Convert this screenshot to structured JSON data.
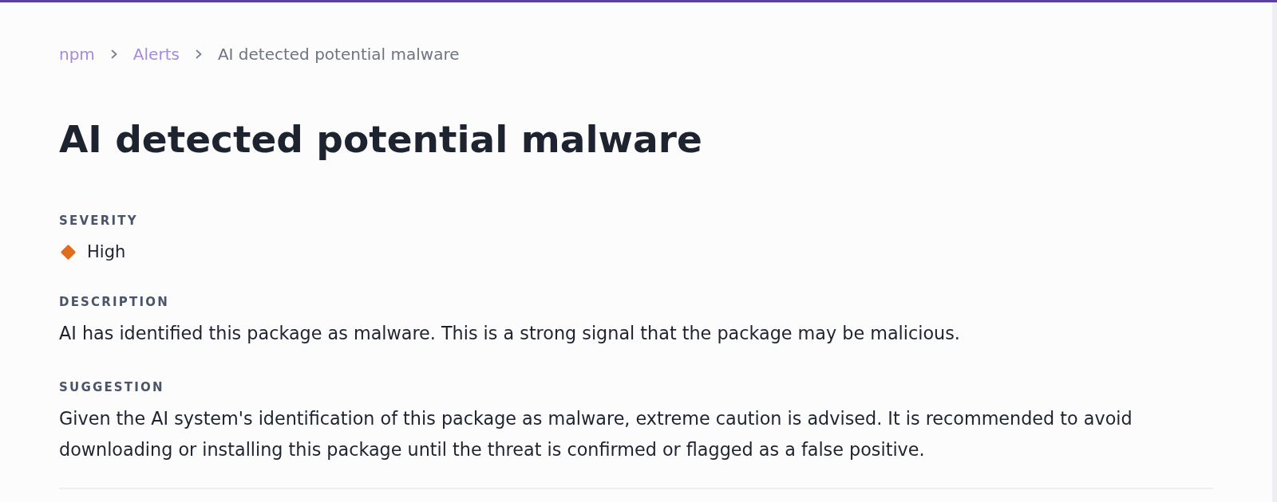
{
  "breadcrumb": [
    {
      "label": "npm",
      "current": false
    },
    {
      "label": "Alerts",
      "current": false
    },
    {
      "label": "AI detected potential malware",
      "current": true
    }
  ],
  "title": "AI detected potential malware",
  "sections": [
    {
      "kind": "severity",
      "label": "SEVERITY",
      "value": "High",
      "color": "#e06c1f"
    },
    {
      "kind": "text",
      "label": "DESCRIPTION",
      "text": "AI has identified this package as malware. This is a strong signal that the package may be malicious."
    },
    {
      "kind": "text",
      "label": "SUGGESTION",
      "text": "Given the AI system's identification of this package as malware, extreme caution is advised. It is recommended to avoid downloading or installing this package until the threat is confirmed or flagged as a false positive."
    }
  ]
}
